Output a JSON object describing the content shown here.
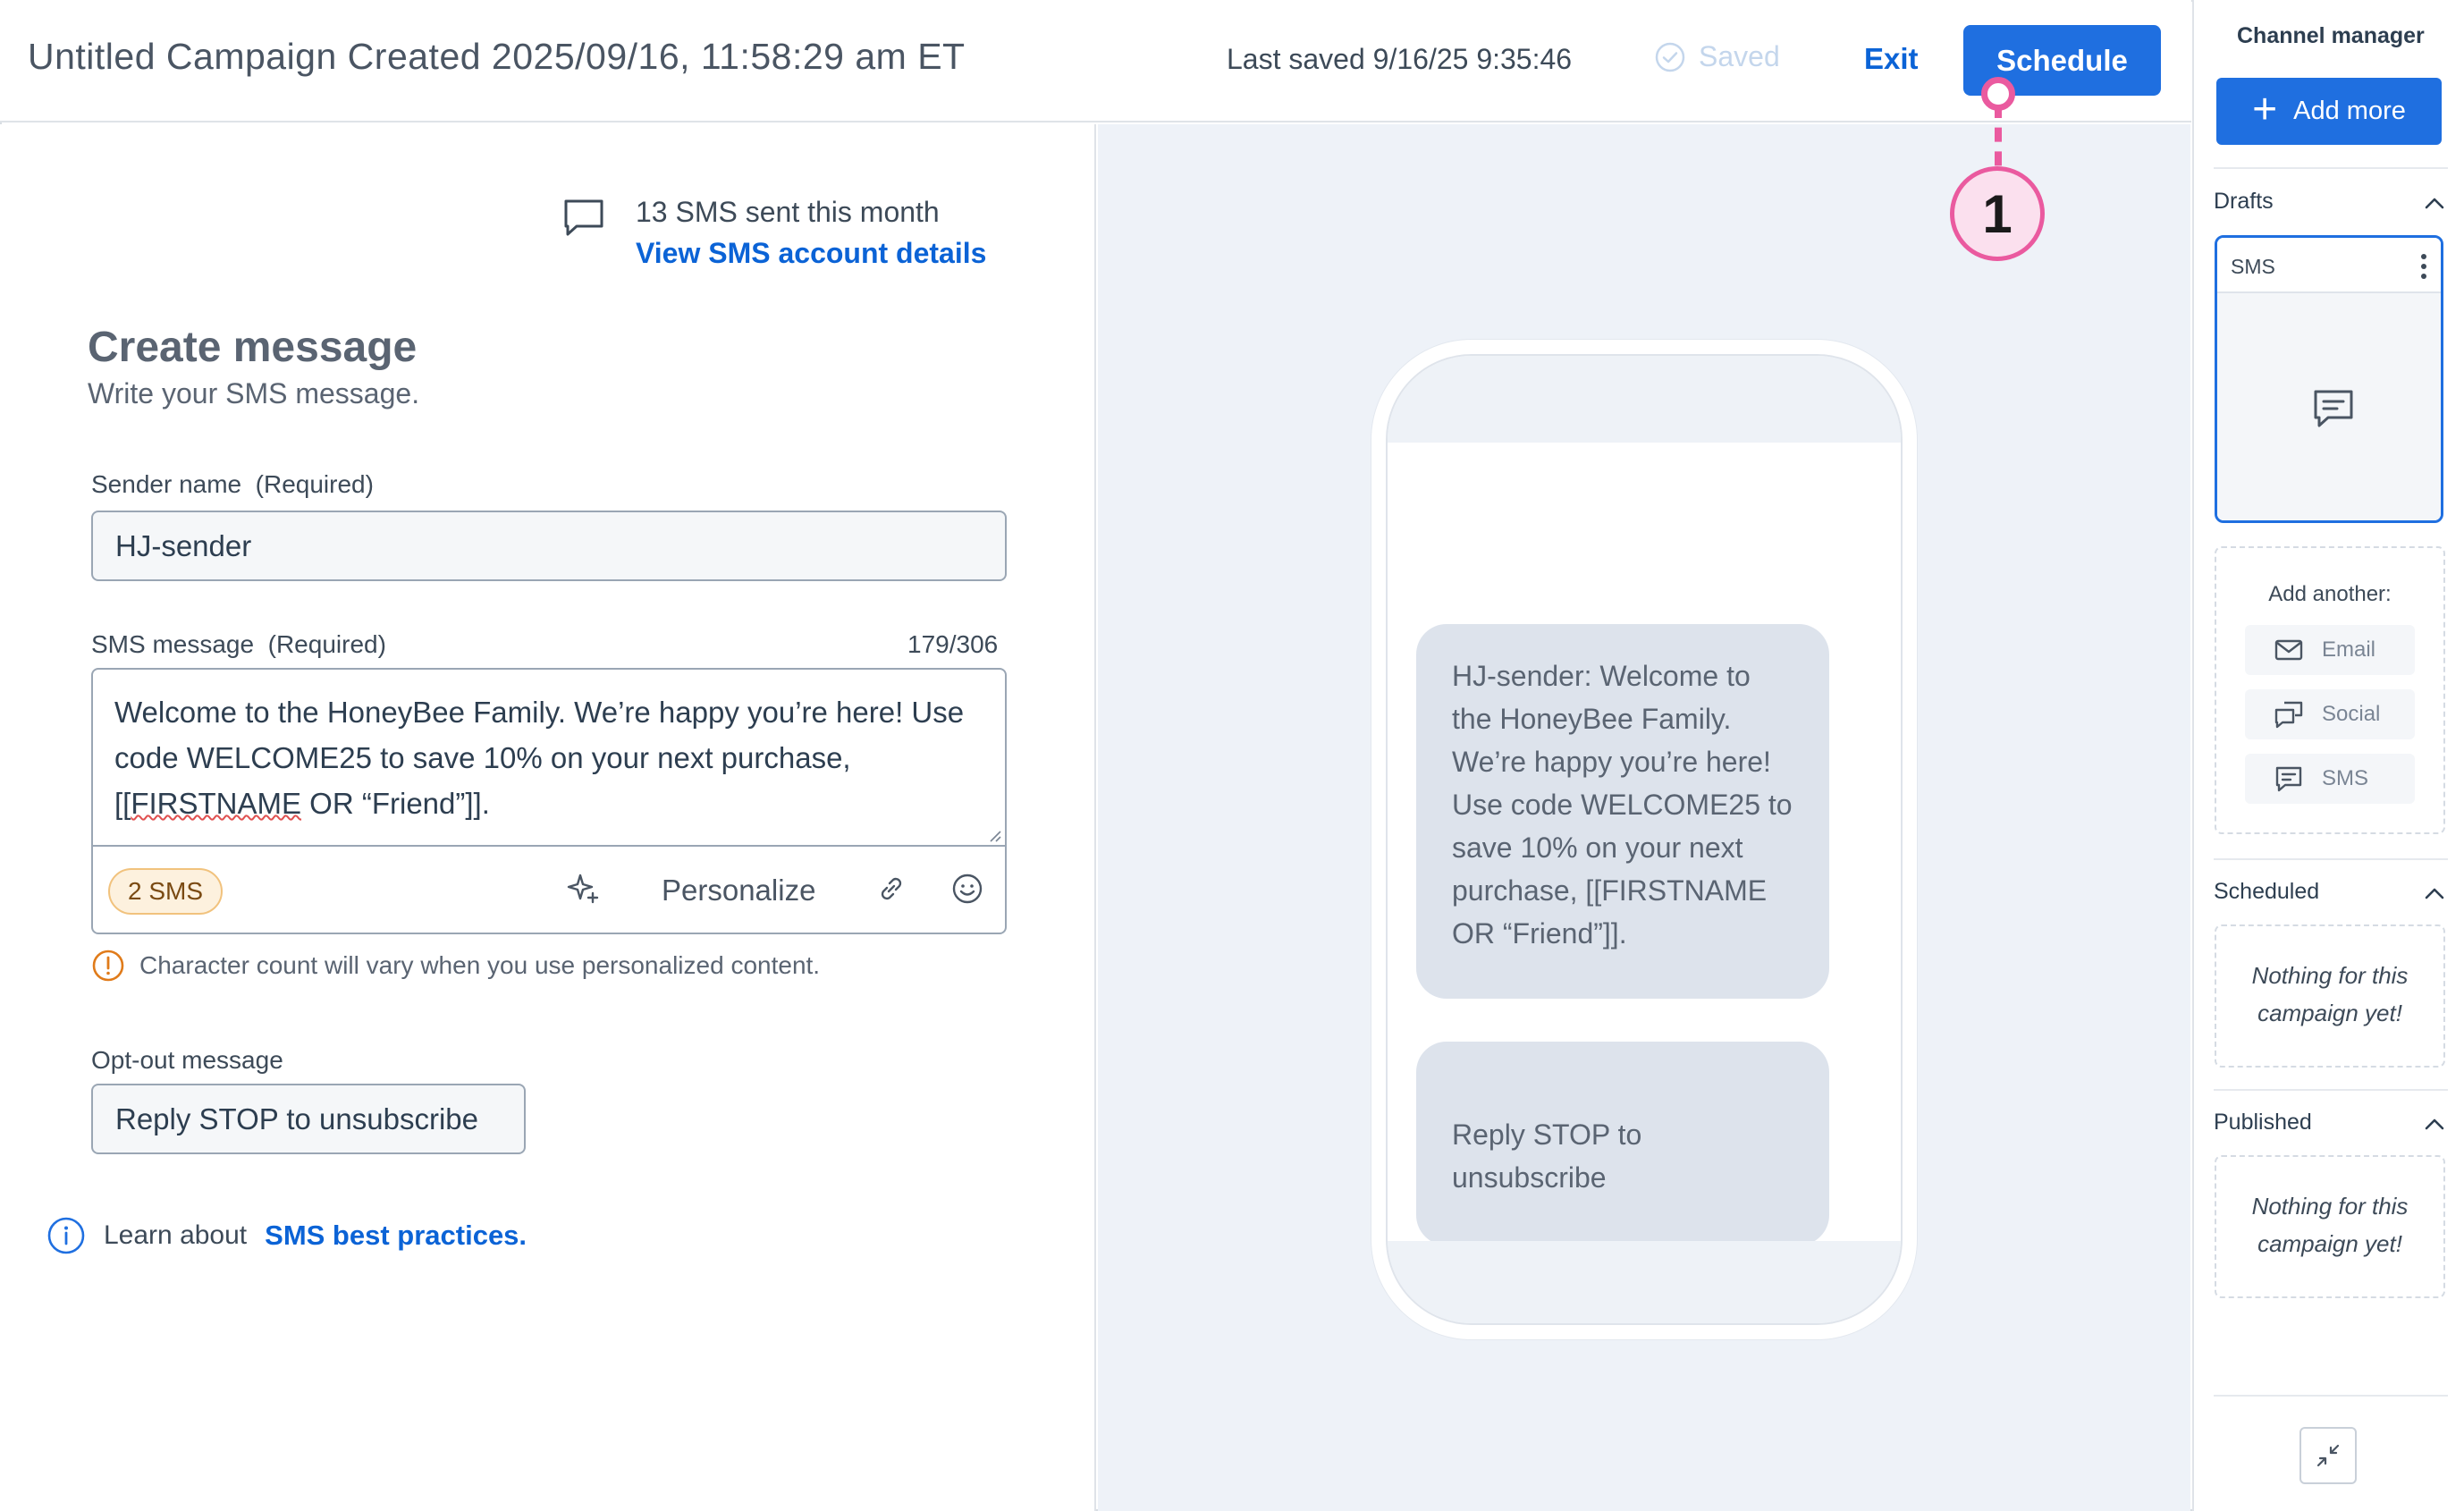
{
  "header": {
    "campaign_title": "Untitled Campaign Created 2025/09/16, 11:58:29 am ET",
    "last_saved": "Last saved 9/16/25 9:35:46",
    "saved_status": "Saved",
    "exit_label": "Exit",
    "schedule_label": "Schedule"
  },
  "callout": {
    "number": "1",
    "color": "#ea5a9f"
  },
  "sms_usage": {
    "count_text": "13 SMS sent this month",
    "account_link": "View SMS account details",
    "icon": "chat-bubble-icon"
  },
  "form": {
    "title": "Create message",
    "subtitle": "Write your SMS message.",
    "sender_label": "Sender name",
    "sender_required": "(Required)",
    "sender_value": "HJ-sender",
    "message_label": "SMS message",
    "message_required": "(Required)",
    "char_count": "179/306",
    "message_part1": "Welcome to the HoneyBee Family. We’re happy you’re here! Use code WELCOME25 to save 10% on your next purchase, [[",
    "message_spell": "FIRSTNAME",
    "message_part2": " OR “Friend”]].",
    "sms_pill": "2 SMS",
    "personalize_label": "Personalize",
    "warning_text": "Character count will vary when you use personalized content.",
    "optout_label": "Opt-out message",
    "optout_value": "Reply STOP to unsubscribe",
    "info_prefix": "Learn about",
    "info_link": "SMS best practices."
  },
  "preview": {
    "bubble_message": "HJ-sender: Welcome to the HoneyBee Family. We’re happy you’re here! Use code WELCOME25 to save 10% on your next purchase, [[FIRSTNAME OR “Friend”]].",
    "bubble_optout": "Reply STOP to unsubscribe"
  },
  "sidebar": {
    "title": "Channel manager",
    "add_more": "Add more",
    "drafts_label": "Drafts",
    "draft_card_label": "SMS",
    "add_another": "Add another:",
    "channels": [
      "Email",
      "Social",
      "SMS"
    ],
    "scheduled_label": "Scheduled",
    "scheduled_empty": "Nothing for this campaign yet!",
    "published_label": "Published",
    "published_empty": "Nothing for this campaign yet!"
  },
  "colors": {
    "accent": "#1f6fe0",
    "link": "#0b63d6",
    "warning": "#e07b1a",
    "pill_bg": "#fdf1de"
  }
}
